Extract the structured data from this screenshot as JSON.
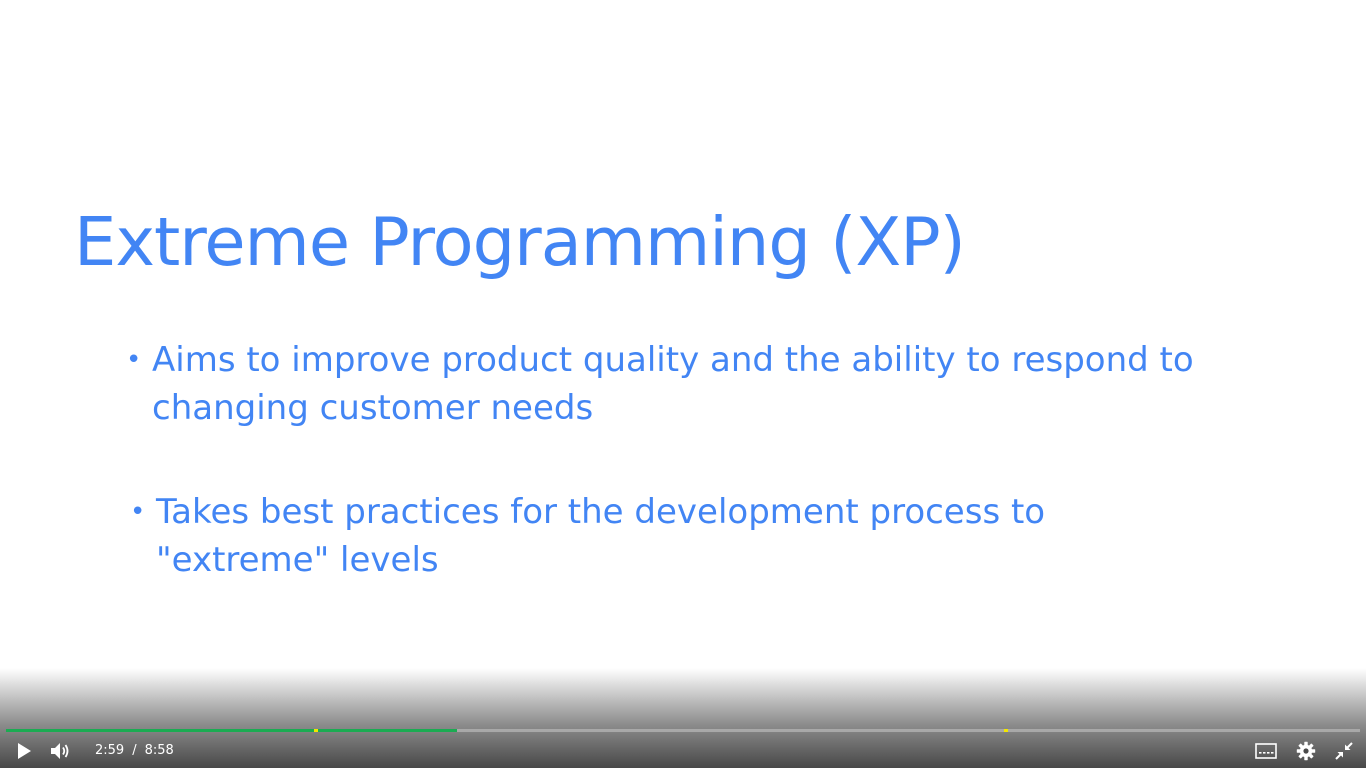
{
  "slide": {
    "title": "Extreme Programming (XP)",
    "bullets": [
      {
        "marker": "•",
        "text": "Aims to improve product quality and the ability to respond to changing customer needs"
      },
      {
        "marker": "•",
        "text": "Takes best practices for the development process to \"extreme\" levels"
      }
    ]
  },
  "player": {
    "current_time": "2:59",
    "separator": "/",
    "duration": "8:58",
    "progress_fraction": 0.333,
    "icons": {
      "play": "play-icon",
      "volume": "volume-icon",
      "captions": "captions-icon",
      "settings": "gear-icon",
      "exit_fullscreen": "exit-fullscreen-icon"
    },
    "colors": {
      "progress_played": "#1bab52",
      "chapter_marker": "#f2e600",
      "title_text": "#4285f4"
    }
  }
}
